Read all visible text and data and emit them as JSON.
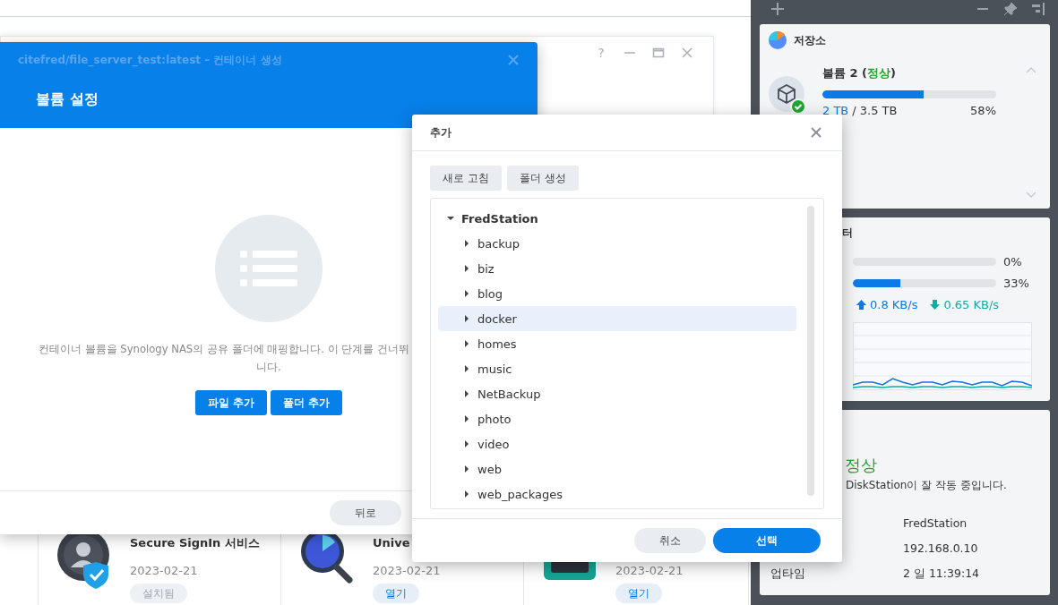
{
  "background_page": {
    "window": {
      "help": "?"
    },
    "packages": [
      {
        "title": "Secure SignIn 서비스",
        "date": "2023-02-21",
        "action": "설치됨",
        "installed": true,
        "kind": "shield"
      },
      {
        "title": "Unive",
        "date": "2023-02-21",
        "action": "열기",
        "installed": false,
        "kind": "magnifier"
      },
      {
        "date": "2023-02-21",
        "action": "열기",
        "installed": false,
        "kind": "box"
      }
    ]
  },
  "widget_panel": {
    "storage": {
      "title": "저장소",
      "volume_label": "볼륨 2 (",
      "status": "정상",
      "status_close": ")",
      "level": 0.58,
      "used": "2 TB",
      "total": "/ 3.5 TB",
      "percent": "58%"
    },
    "resource_monitor": {
      "title": "터",
      "meters": [
        {
          "level": 0,
          "reading": "0%"
        },
        {
          "level": 0.33,
          "reading": "33%"
        }
      ],
      "upload": "0.8 KB/s",
      "download": "0.65 KB/s"
    },
    "health": {
      "status": "정상",
      "message": "DiskStation이 잘 작동 중입니다.",
      "rows": [
        {
          "value": "FredStation"
        },
        {
          "value": "192.168.0.10"
        },
        {
          "label": "업타임",
          "value": "2 일 11:39:14"
        }
      ]
    }
  },
  "volume_dialog": {
    "title": "citefred/file_server_test:latest – 컨테이너 생성",
    "heading": "볼륨 설정",
    "description_lines": [
      "컨테이너 볼륨을 Synology NAS의 공유 폴더에 매핑합니다. 이 단계를 건너뛰",
      "니다."
    ],
    "buttons": [
      "파일 추가",
      "폴더 추가"
    ],
    "footer_buttons": [
      "뒤로"
    ]
  },
  "add_dialog": {
    "title": "추가",
    "toolbar": [
      "새로 고침",
      "폴더 생성"
    ],
    "tree": [
      {
        "label": "FredStation",
        "expanded": true,
        "selected": false,
        "children": [
          {
            "label": "backup",
            "expanded": false,
            "selected": false
          },
          {
            "label": "biz",
            "expanded": false,
            "selected": false
          },
          {
            "label": "blog",
            "expanded": false,
            "selected": false
          },
          {
            "label": "docker",
            "expanded": false,
            "selected": true
          },
          {
            "label": "homes",
            "expanded": false,
            "selected": false
          },
          {
            "label": "music",
            "expanded": false,
            "selected": false
          },
          {
            "label": "NetBackup",
            "expanded": false,
            "selected": false
          },
          {
            "label": "photo",
            "expanded": false,
            "selected": false
          },
          {
            "label": "video",
            "expanded": false,
            "selected": false
          },
          {
            "label": "web",
            "expanded": false,
            "selected": false
          },
          {
            "label": "web_packages",
            "expanded": false,
            "selected": false
          }
        ]
      }
    ],
    "buttons": [
      {
        "label": "취소",
        "kind": "secondary"
      },
      {
        "label": "선택",
        "kind": "primary"
      }
    ]
  }
}
